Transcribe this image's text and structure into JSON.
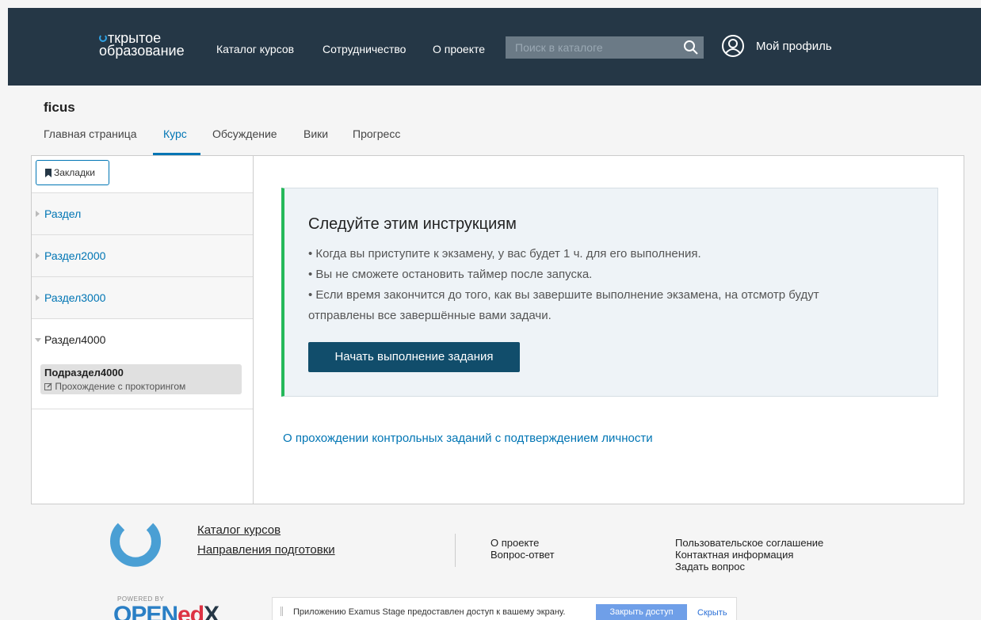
{
  "header": {
    "logo_line1": "ткрытое",
    "logo_line2": "образование",
    "nav": [
      "Каталог курсов",
      "Сотрудничество",
      "О проекте"
    ],
    "search_placeholder": "Поиск в каталоге",
    "profile": "Мой профиль"
  },
  "course": {
    "title": "ficus",
    "tabs": [
      "Главная страница",
      "Курс",
      "Обсуждение",
      "Вики",
      "Прогресс"
    ],
    "active_tab": "Курс"
  },
  "sidebar": {
    "bookmarks": "Закладки",
    "sections": [
      "Раздел",
      "Раздел2000",
      "Раздел3000",
      "Раздел4000"
    ],
    "subsection_title": "Подраздел4000",
    "subsection_subtitle": "Прохождение с прокторингом"
  },
  "instructions": {
    "title": "Следуйте этим инструкциям",
    "lines": [
      "• Когда вы приступите к экзамену, у вас будет 1 ч. для его выполнения.",
      "• Вы не сможете остановить таймер после запуска.",
      "• Если время закончится до того, как вы завершите выполнение экзамена, на отсмотр будут",
      "отправлены все завершённые вами задачи."
    ],
    "start_button": "Начать выполнение задания",
    "proctoring_link": "О прохождении контрольных заданий с подтверждением личности"
  },
  "footer": {
    "links": [
      "Каталог курсов",
      "Направления подготовки"
    ],
    "col2": [
      "О проекте",
      "Вопрос-ответ"
    ],
    "col3": [
      "Пользовательское соглашение",
      "Контактная информация",
      "Задать вопрос"
    ],
    "powered_by": "POWERED BY",
    "openedx_open": "OPEN",
    "openedx_ed": "ed",
    "openedx_x": "X"
  },
  "sharebar": {
    "message": "Приложению Examus Stage предоставлен доступ к вашему экрану.",
    "stop": "Закрыть доступ",
    "hide": "Скрыть"
  },
  "colors": {
    "header_bg": "#253746",
    "accent": "#0075b4",
    "instruction_border": "#25b85a",
    "start_button": "#114d6b"
  }
}
